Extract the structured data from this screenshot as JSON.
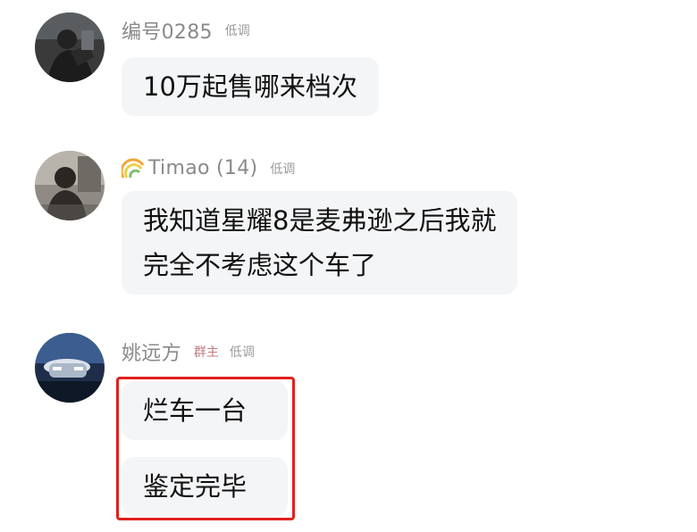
{
  "messages": [
    {
      "sender": "编号0285",
      "tags": [
        "低调"
      ],
      "bubbles": [
        "10万起售哪来档次"
      ]
    },
    {
      "sender": "Timao (14)",
      "sender_icon": "rainbow-icon",
      "tags": [
        "低调"
      ],
      "bubbles": [
        "我知道星耀8是麦弗逊之后我就",
        "完全不考虑这个车了"
      ]
    },
    {
      "sender": "姚远方",
      "role_tag": "群主",
      "tags": [
        "低调"
      ],
      "bubbles": [
        "烂车一台",
        "鉴定完毕"
      ]
    }
  ],
  "colors": {
    "bubble_bg": "#f4f5f7",
    "name_text": "#8a8a8a",
    "owner_tag": "#c07a80",
    "highlight_border": "#e0201d"
  }
}
